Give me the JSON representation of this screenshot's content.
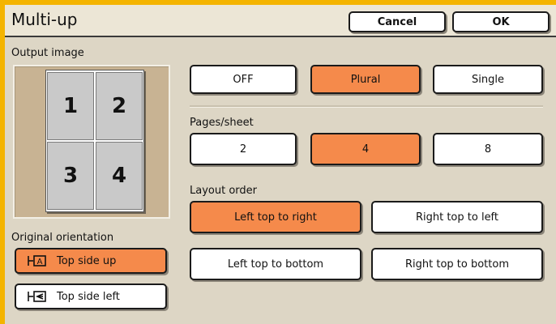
{
  "dialog": {
    "title": "Multi-up",
    "cancel_label": "Cancel",
    "ok_label": "OK"
  },
  "output_image": {
    "label": "Output image",
    "pages": [
      "1",
      "2",
      "3",
      "4"
    ]
  },
  "mode": {
    "options": [
      "OFF",
      "Plural",
      "Single"
    ],
    "selected": "Plural"
  },
  "pages_per_sheet": {
    "label": "Pages/sheet",
    "options": [
      "2",
      "4",
      "8"
    ],
    "selected": "4"
  },
  "layout_order": {
    "label": "Layout order",
    "options": [
      "Left top to right",
      "Right top to left",
      "Left top to bottom",
      "Right top to bottom"
    ],
    "selected": "Left top to right"
  },
  "original_orientation": {
    "label": "Original orientation",
    "options": [
      "Top side up",
      "Top side left"
    ],
    "selected": "Top side up"
  },
  "colors": {
    "accent": "#f58a4b",
    "outer_border": "#f4b400",
    "panel": "#ddd6c5"
  }
}
